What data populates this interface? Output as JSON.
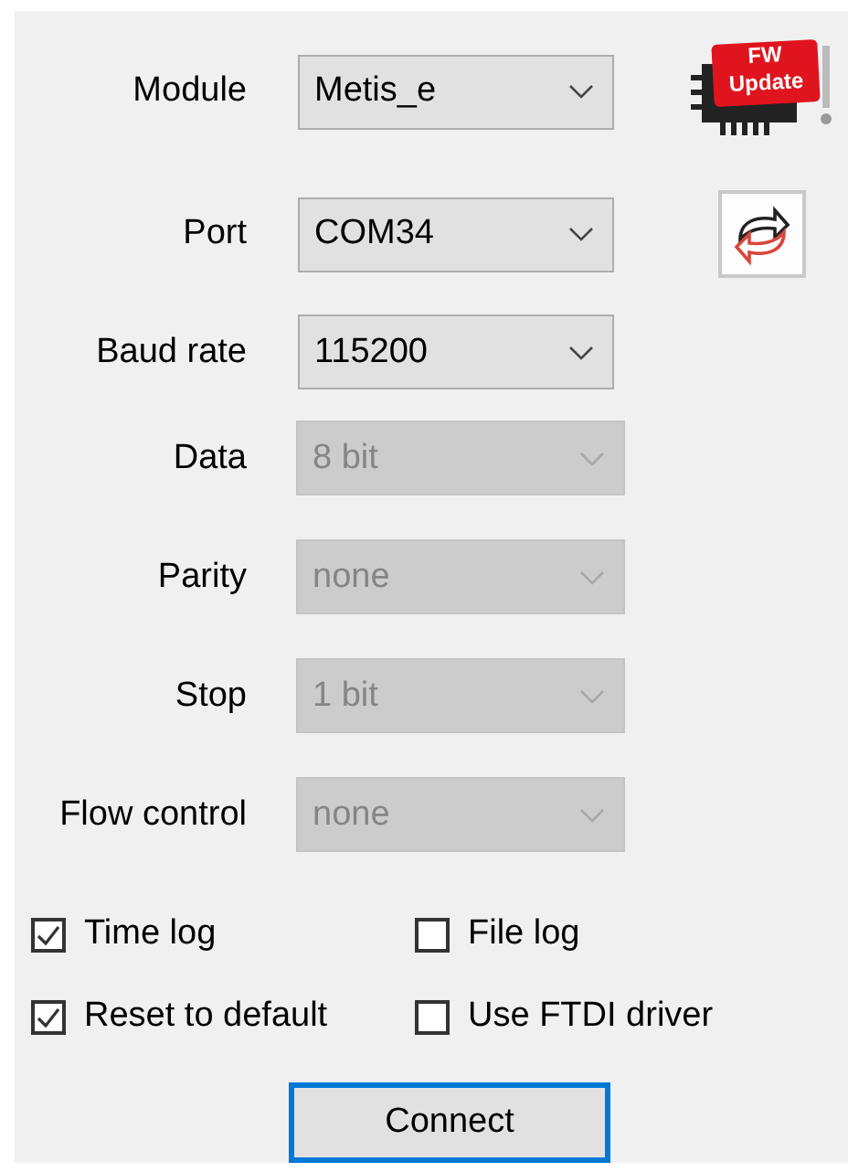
{
  "fields": [
    {
      "label": "Module",
      "value": "Metis_e",
      "disabled": false,
      "action": {
        "kind": "fw_update",
        "lines": [
          "FW",
          "Update"
        ]
      }
    },
    {
      "label": "Port",
      "value": "COM34",
      "disabled": false,
      "action": {
        "kind": "refresh"
      }
    },
    {
      "label": "Baud rate",
      "value": "115200",
      "disabled": false
    },
    {
      "label": "Data",
      "value": "8 bit",
      "disabled": true
    },
    {
      "label": "Parity",
      "value": "none",
      "disabled": true
    },
    {
      "label": "Stop",
      "value": "1 bit",
      "disabled": true
    },
    {
      "label": "Flow control",
      "value": "none",
      "disabled": true
    }
  ],
  "options": [
    {
      "label": "Time log",
      "checked": true
    },
    {
      "label": "File log",
      "checked": false
    },
    {
      "label": "Reset to default",
      "checked": true
    },
    {
      "label": "Use FTDI driver",
      "checked": false
    }
  ],
  "buttons": [
    {
      "label": "Connect",
      "focused": true
    }
  ]
}
